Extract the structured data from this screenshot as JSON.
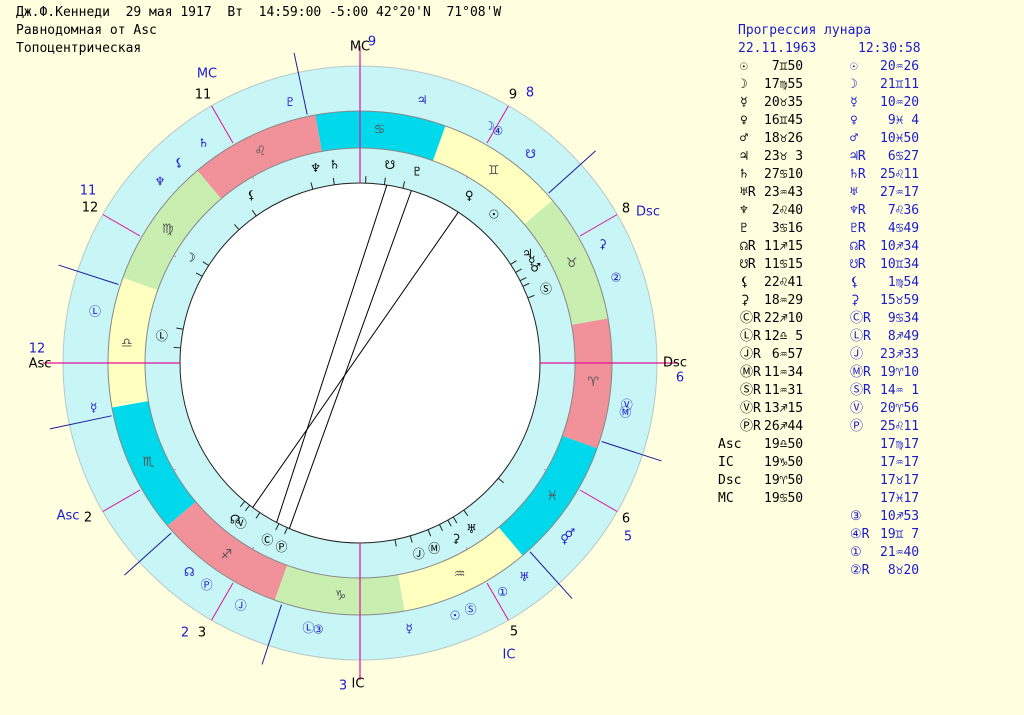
{
  "header": {
    "line1": "Дж.Ф.Кеннеди  29 мая 1917  Вт  14:59:00 -5:00 42°20'N  71°08'W",
    "line2": "Равнодомная от Asc",
    "line3": "Топоцентрическая"
  },
  "table": {
    "title": "Прогрессия лунара",
    "date": "22.11.1963",
    "time": "12:30:58",
    "rows": [
      {
        "s1": "☉",
        "v1": " 7♊50",
        "s2": "☉",
        "v2": "20♒26"
      },
      {
        "s1": "☽",
        "v1": "17♍55",
        "s2": "☽",
        "v2": "21♊11"
      },
      {
        "s1": "☿",
        "v1": "20♉35",
        "s2": "☿",
        "v2": "10♒20"
      },
      {
        "s1": "♀",
        "v1": "16♊45",
        "s2": "♀",
        "v2": " 9♓ 4"
      },
      {
        "s1": "♂",
        "v1": "18♉26",
        "s2": "♂",
        "v2": "10♓50"
      },
      {
        "s1": "♃",
        "v1": "23♉ 3",
        "s2": "♃R",
        "v2": " 6♋27"
      },
      {
        "s1": "♄",
        "v1": "27♋10",
        "s2": "♄R",
        "v2": "25♌11"
      },
      {
        "s1": "♅R",
        "v1": "23♒43",
        "s2": "♅",
        "v2": "27♒17"
      },
      {
        "s1": "♆",
        "v1": " 2♌40",
        "s2": "♆R",
        "v2": " 7♌36"
      },
      {
        "s1": "♇",
        "v1": " 3♋16",
        "s2": "♇R",
        "v2": " 4♋49"
      },
      {
        "s1": "☊R",
        "v1": "11♐15",
        "s2": "☊R",
        "v2": "10♐34"
      },
      {
        "s1": "☋R",
        "v1": "11♋15",
        "s2": "☋R",
        "v2": "10♊34"
      },
      {
        "s1": "⚸",
        "v1": "22♌41",
        "s2": "⚸",
        "v2": " 1♍54"
      },
      {
        "s1": "⚳",
        "v1": "18♒29",
        "s2": "⚳",
        "v2": "15♉59"
      },
      {
        "s1": "ⒸR",
        "v1": "22♐10",
        "s2": "ⒸR",
        "v2": " 9♋34"
      },
      {
        "s1": "ⓁR",
        "v1": "12♎ 5",
        "s2": "ⓁR",
        "v2": " 8♐49"
      },
      {
        "s1": "ⒿR",
        "v1": " 6♒57",
        "s2": "Ⓙ",
        "v2": "23♐33"
      },
      {
        "s1": "ⓂR",
        "v1": "11♒34",
        "s2": "ⓂR",
        "v2": "19♈10"
      },
      {
        "s1": "ⓈR",
        "v1": "11♒31",
        "s2": "ⓈR",
        "v2": "14♒ 1"
      },
      {
        "s1": "ⓋR",
        "v1": "13♐15",
        "s2": "Ⓥ",
        "v2": "20♈56"
      },
      {
        "s1": "ⓅR",
        "v1": "26♐44",
        "s2": "Ⓟ",
        "v2": "25♌11"
      }
    ],
    "angles": [
      {
        "label": "Asc",
        "v1": "19♎50",
        "v2": "17♍17"
      },
      {
        "label": "IC",
        "v1": "19♑50",
        "v2": "17♒17"
      },
      {
        "label": "Dsc",
        "v1": "19♈50",
        "v2": "17♉17"
      },
      {
        "label": "MC",
        "v1": "19♋50",
        "v2": "17♓17"
      }
    ],
    "extra": [
      {
        "s": "③",
        "v": "10♐53"
      },
      {
        "s": "④R",
        "v": "19♊ 7"
      },
      {
        "s": "①",
        "v": "21♒40"
      },
      {
        "s": "②R",
        "v": " 8♉20"
      }
    ]
  },
  "wheel": {
    "signs": [
      {
        "glyph": "♈",
        "start": 0,
        "color": "#f1919a"
      },
      {
        "glyph": "♉",
        "start": 30,
        "color": "#c8eeb0"
      },
      {
        "glyph": "♊",
        "start": 60,
        "color": "#ffffbf"
      },
      {
        "glyph": "♋",
        "start": 90,
        "color": "#00d8ec"
      },
      {
        "glyph": "♌",
        "start": 120,
        "color": "#f1919a"
      },
      {
        "glyph": "♍",
        "start": 150,
        "color": "#c8eeb0"
      },
      {
        "glyph": "♎",
        "start": 180,
        "color": "#ffffbf"
      },
      {
        "glyph": "♏",
        "start": 210,
        "color": "#00d8ec"
      },
      {
        "glyph": "♐",
        "start": 240,
        "color": "#f1919a"
      },
      {
        "glyph": "♑",
        "start": 270,
        "color": "#c8eeb0"
      },
      {
        "glyph": "♒",
        "start": 300,
        "color": "#ffffbf"
      },
      {
        "glyph": "♓",
        "start": 330,
        "color": "#00d8ec"
      }
    ],
    "ring_color": "#c8f5f5",
    "angle_labels": {
      "mc": "MC",
      "ic": "IC",
      "asc": "Asc",
      "dsc": "Dsc"
    },
    "outer_houses": [
      {
        "num": "9",
        "lon": 109.8
      },
      {
        "num": "8",
        "lon": 49.8
      },
      {
        "num": "6",
        "lon": 349.8
      },
      {
        "num": "5",
        "lon": 319.8
      },
      {
        "num": "3",
        "lon": 259.8
      },
      {
        "num": "2",
        "lon": 229.8
      },
      {
        "num": "11",
        "lon": 169.8
      },
      {
        "num": "12",
        "lon": 199.8
      }
    ],
    "inner_houses": [
      {
        "num": "11",
        "lon": 139.8
      },
      {
        "num": "12",
        "lon": 169.8
      },
      {
        "num": "9",
        "lon": 79.8
      },
      {
        "num": "8",
        "lon": 49.8
      },
      {
        "num": "6",
        "lon": 349.8
      },
      {
        "num": "5",
        "lon": 319.8
      },
      {
        "num": "3",
        "lon": 259.8
      },
      {
        "num": "2",
        "lon": 229.8
      }
    ],
    "natal_planets": [
      {
        "glyph": "♆",
        "lon": 122.6
      },
      {
        "glyph": "♄",
        "lon": 117.1
      },
      {
        "glyph": "☋",
        "lon": 101.2
      },
      {
        "glyph": "♇",
        "lon": 93.2
      },
      {
        "glyph": "♀",
        "lon": 76.7
      },
      {
        "glyph": "☉",
        "lon": 67.8
      },
      {
        "glyph": "☿",
        "lon": 50.6
      },
      {
        "glyph": "♃",
        "lon": 53.0
      },
      {
        "glyph": "♂",
        "lon": 48.4
      },
      {
        "glyph": "Ⓢ",
        "lon": 41.5
      },
      {
        "glyph": "⚸",
        "lon": 142.7
      },
      {
        "glyph": "☽",
        "lon": 167.9
      },
      {
        "glyph": "Ⓛ",
        "lon": 192.0
      },
      {
        "glyph": "Ⓟ",
        "lon": 266.7
      },
      {
        "glyph": "☊",
        "lon": 251.2
      },
      {
        "glyph": "Ⓥ",
        "lon": 253.2
      },
      {
        "glyph": "Ⓒ",
        "lon": 262.2
      },
      {
        "glyph": "Ⓙ",
        "lon": 306.9
      },
      {
        "glyph": "Ⓜ",
        "lon": 311.6
      },
      {
        "glyph": "⚳",
        "lon": 318.5
      },
      {
        "glyph": "♅",
        "lon": 323.7
      }
    ],
    "prog_planets": [
      {
        "glyph": "♇",
        "lon": 124.8
      },
      {
        "glyph": "♃",
        "lon": 96.5
      },
      {
        "glyph": "④",
        "lon": 79.1
      },
      {
        "glyph": "☽",
        "lon": 81.2
      },
      {
        "glyph": "☋",
        "lon": 70.6
      },
      {
        "glyph": "♆",
        "lon": 157.6
      },
      {
        "glyph": "♄",
        "lon": 145.2
      },
      {
        "glyph": "⚸",
        "lon": 151.9
      },
      {
        "glyph": "Ⓛ",
        "lon": 188.8
      },
      {
        "glyph": "☿",
        "lon": 209.3
      },
      {
        "glyph": "⚳",
        "lon": 45.9
      },
      {
        "glyph": "②",
        "lon": 38.3
      },
      {
        "glyph": "Ⓥ",
        "lon": 10.9
      },
      {
        "glyph": "Ⓜ",
        "lon": 9.2
      },
      {
        "glyph": "♀",
        "lon": 339.1
      },
      {
        "glyph": "♂",
        "lon": 340.8
      },
      {
        "glyph": "♅",
        "lon": 327.3
      },
      {
        "glyph": "☉",
        "lon": 310.4
      },
      {
        "glyph": "①",
        "lon": 321.7
      },
      {
        "glyph": "☿",
        "lon": 300.3
      },
      {
        "glyph": "Ⓢ",
        "lon": 314.0
      },
      {
        "glyph": "Ⓙ",
        "lon": 263.6
      },
      {
        "glyph": "Ⓟ",
        "lon": 255.2
      },
      {
        "glyph": "☊",
        "lon": 250.6
      },
      {
        "glyph": "Ⓛ",
        "lon": 278.8
      },
      {
        "glyph": "③",
        "lon": 280.9
      }
    ],
    "aspect_lines": [
      {
        "from": 93.2,
        "to": 266.7
      },
      {
        "from": 76.7,
        "to": 253.2
      },
      {
        "from": 101.2,
        "to": 262.2
      }
    ]
  }
}
